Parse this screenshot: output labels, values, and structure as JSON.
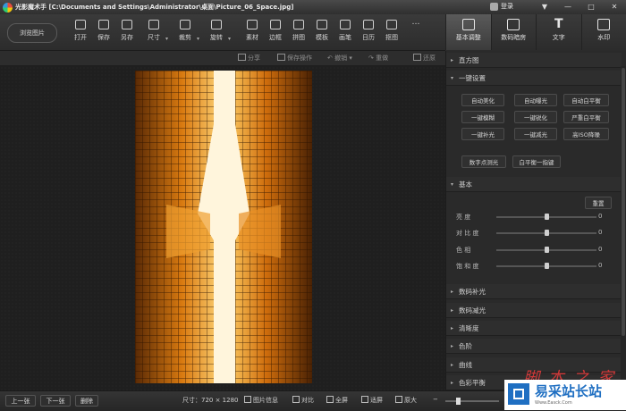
{
  "window": {
    "app_title": "光影魔术手",
    "path": "[C:\\Documents and Settings\\Administrator\\桌面\\Picture_06_Space.jpg]",
    "login_label": "登录",
    "controls": [
      "▼",
      "—",
      "□",
      "✕"
    ]
  },
  "toolbar": {
    "browse_label": "浏览图片",
    "tools": [
      {
        "label": "打开",
        "icon": "open-icon"
      },
      {
        "label": "保存",
        "icon": "save-icon"
      },
      {
        "label": "另存",
        "icon": "save-as-icon"
      },
      {
        "label": "尺寸",
        "icon": "resize-icon"
      },
      {
        "label": "裁剪",
        "icon": "crop-icon"
      },
      {
        "label": "旋转",
        "icon": "rotate-icon"
      },
      {
        "label": "素材",
        "icon": "material-icon"
      },
      {
        "label": "边框",
        "icon": "border-icon"
      },
      {
        "label": "拼图",
        "icon": "puzzle-icon"
      },
      {
        "label": "模板",
        "icon": "template-icon"
      },
      {
        "label": "画笔",
        "icon": "brush-icon"
      },
      {
        "label": "日历",
        "icon": "calendar-icon"
      },
      {
        "label": "抠图",
        "icon": "cutout-icon"
      }
    ],
    "more": "…"
  },
  "right_tabs": [
    {
      "label": "基本调整",
      "icon": "edit-icon",
      "active": true
    },
    {
      "label": "数码暗房",
      "icon": "camera-icon",
      "active": false
    },
    {
      "label": "文字",
      "icon": "text-icon",
      "active": false
    },
    {
      "label": "水印",
      "icon": "watermark-icon",
      "active": false
    }
  ],
  "actions": {
    "share": "分享",
    "save_op": "保存操作",
    "undo": "撤销",
    "redo": "重做",
    "restore": "还原"
  },
  "panel": {
    "histogram": "直方图",
    "one_click": "一键设置",
    "buttons": [
      "自动美化",
      "自动曝光",
      "自动白平衡",
      "一键模糊",
      "一键锐化",
      "严重白平衡",
      "一键补光",
      "一键减光",
      "高ISO降噪"
    ],
    "wb_buttons": [
      "数字点测光",
      "白平衡一指键"
    ],
    "basic": "基本",
    "reset": "重置",
    "sliders": [
      {
        "label": "亮  度",
        "value": "0",
        "fraction": 0.5
      },
      {
        "label": "对 比 度",
        "value": "0",
        "fraction": 0.5
      },
      {
        "label": "色    相",
        "value": "0",
        "fraction": 0.5
      },
      {
        "label": "饱 和 度",
        "value": "0",
        "fraction": 0.5
      }
    ],
    "sections": [
      "数码补光",
      "数码减光",
      "清晰度",
      "色阶",
      "曲线",
      "色彩平衡"
    ]
  },
  "status": {
    "prev": "上一张",
    "next": "下一张",
    "delete": "删除",
    "size": "尺寸：720 × 1280",
    "info": "图片信息",
    "compare": "对比",
    "fullscreen": "全屏",
    "fit": "适屏",
    "original": "原大"
  },
  "watermark": {
    "red_text": "脚 本 之 家",
    "brand": "易采站长站",
    "url": "Www.Easck.Com"
  }
}
